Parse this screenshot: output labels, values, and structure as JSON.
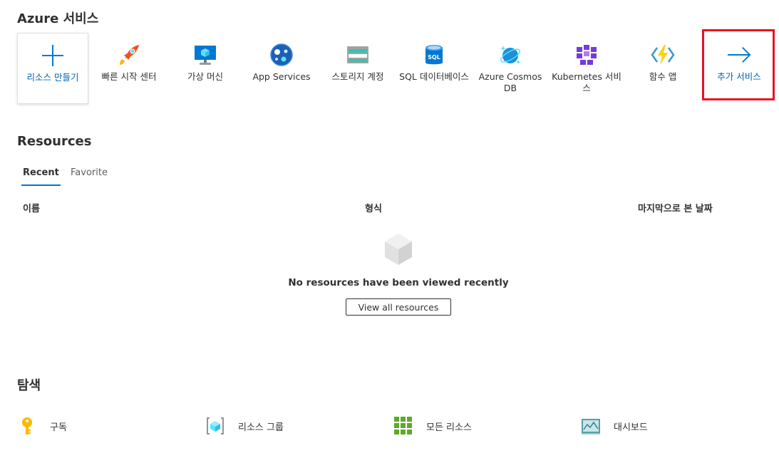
{
  "services_section": {
    "title": "Azure 서비스",
    "items": [
      {
        "label": "리소스 만들기",
        "icon": "plus-icon"
      },
      {
        "label": "빠른 시작 센터",
        "icon": "rocket-icon"
      },
      {
        "label": "가상 머신",
        "icon": "virtual-machine-icon"
      },
      {
        "label": "App Services",
        "icon": "app-services-icon"
      },
      {
        "label": "스토리지 계정",
        "icon": "storage-account-icon"
      },
      {
        "label": "SQL 데이터베이스",
        "icon": "sql-database-icon"
      },
      {
        "label": "Azure Cosmos DB",
        "icon": "cosmos-db-icon"
      },
      {
        "label": "Kubernetes 서비스",
        "icon": "kubernetes-icon"
      },
      {
        "label": "함수 앱",
        "icon": "function-app-icon"
      },
      {
        "label": "추가 서비스",
        "icon": "arrow-right-icon"
      }
    ]
  },
  "resources_section": {
    "title": "Resources",
    "tabs": [
      "Recent",
      "Favorite"
    ],
    "columns": [
      "이름",
      "형식",
      "마지막으로 본 날짜"
    ],
    "empty_message": "No resources have been viewed recently",
    "view_all_label": "View all resources"
  },
  "navigate_section": {
    "title": "탐색",
    "items": [
      {
        "label": "구독",
        "icon": "key-icon"
      },
      {
        "label": "리소스 그룹",
        "icon": "resource-group-icon"
      },
      {
        "label": "모든 리소스",
        "icon": "grid-icon"
      },
      {
        "label": "대시보드",
        "icon": "dashboard-icon"
      }
    ]
  },
  "colors": {
    "accent": "#0078d4",
    "link": "#0063b1",
    "highlight_border": "#e81123"
  }
}
